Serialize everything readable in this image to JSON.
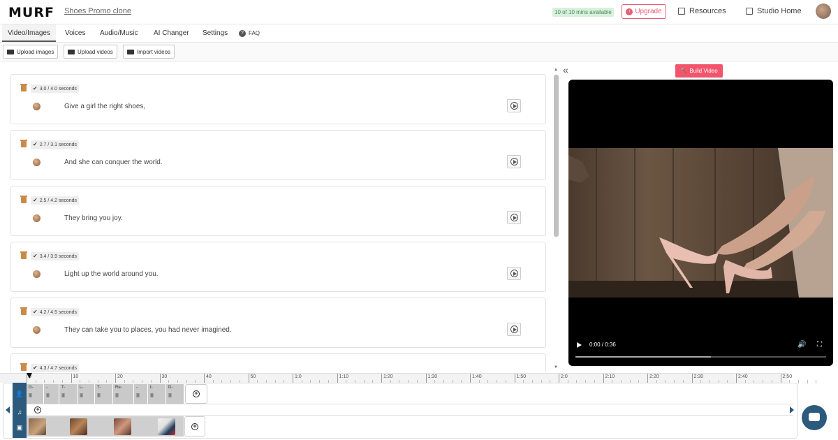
{
  "header": {
    "logo": "MURF",
    "project_name": "Shoes Promo clone",
    "mins_available": "10 of 10 mins available",
    "upgrade_label": "Upgrade",
    "resources_label": "Resources",
    "studio_home_label": "Studio Home",
    "accent_color": "#e85d75"
  },
  "tabs": [
    {
      "label": "Video/Images",
      "active": true
    },
    {
      "label": "Voices"
    },
    {
      "label": "Audio/Music"
    },
    {
      "label": "AI Changer"
    },
    {
      "label": "Settings"
    },
    {
      "label": "FAQ"
    }
  ],
  "toolbar": {
    "upload_images": "Upload images",
    "upload_videos": "Upload videos",
    "import_videos": "Import videos"
  },
  "scenes": [
    {
      "duration": "3.0 / 4.0 seconds",
      "text": "Give a girl the right shoes,"
    },
    {
      "duration": "2.7 / 3.1 seconds",
      "text": "And she can conquer the world."
    },
    {
      "duration": "2.5 / 4.2 seconds",
      "text": "They bring you joy."
    },
    {
      "duration": "3.4 / 3.9 seconds",
      "text": "Light up the world around you."
    },
    {
      "duration": "4.2 / 4.5 seconds",
      "text": "They can take you to places, you had never imagined."
    },
    {
      "duration": "4.3 / 4.7 seconds",
      "text": ""
    }
  ],
  "preview": {
    "build_video_label": "Build Video",
    "time": "0:00 / 0:36",
    "progress": 0.54
  },
  "timeline": {
    "ticks": [
      "0",
      "10",
      "20",
      "30",
      "40",
      "50",
      "1:0",
      "1:10",
      "1:20",
      "1:30",
      "1:40",
      "1:50",
      "2:0",
      "2:10",
      "2:20",
      "2:30",
      "2:40",
      "2:50"
    ],
    "voice_blocks": [
      "G-",
      "-",
      "T-",
      "L-",
      "T-",
      "Re-",
      "-",
      "t-",
      "D-"
    ]
  }
}
